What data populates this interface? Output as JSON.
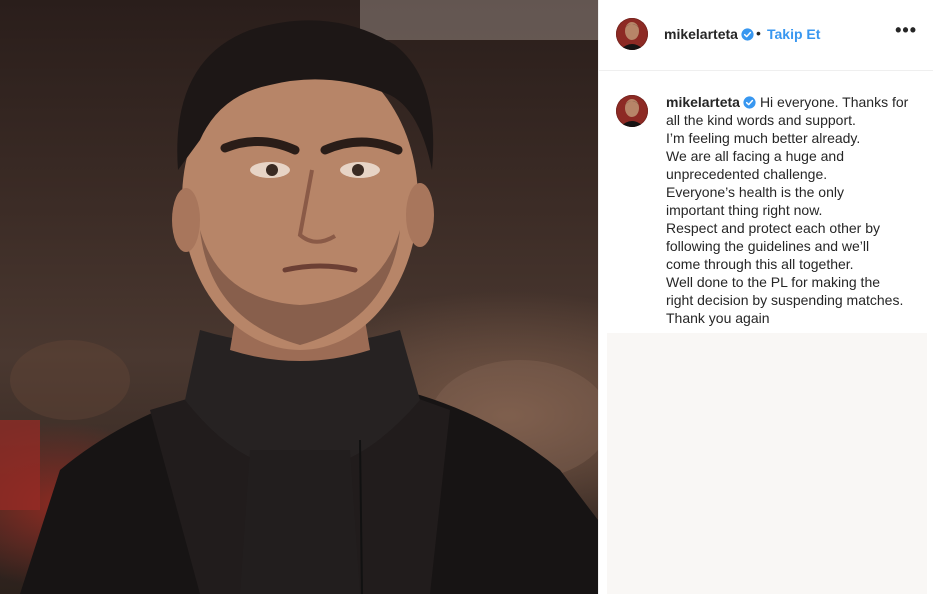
{
  "post": {
    "image_alt": "Man in black turtleneck and coat",
    "author": {
      "username": "mikelarteta",
      "verified": true
    },
    "header": {
      "separator": "•",
      "follow_label": "Takip Et",
      "more_label": "•••"
    },
    "caption": {
      "username": "mikelarteta",
      "lines": [
        "Hi everyone. Thanks for",
        "all the kind words and support.",
        "I’m feeling much better already.",
        "We are all facing a huge and",
        "unprecedented challenge.",
        "Everyone’s health is the only",
        "important thing right now.",
        "Respect and protect each other by",
        "following the guidelines and we’ll",
        "come through this all together.",
        "Well done to the PL for making the",
        "right decision by suspending matches.",
        "Thank you again"
      ]
    }
  },
  "colors": {
    "link_blue": "#3897f0",
    "verified_blue": "#3897f0",
    "text": "#262626",
    "divider": "#efefef"
  },
  "icons": [
    "verified-badge-icon",
    "more-options-icon"
  ]
}
